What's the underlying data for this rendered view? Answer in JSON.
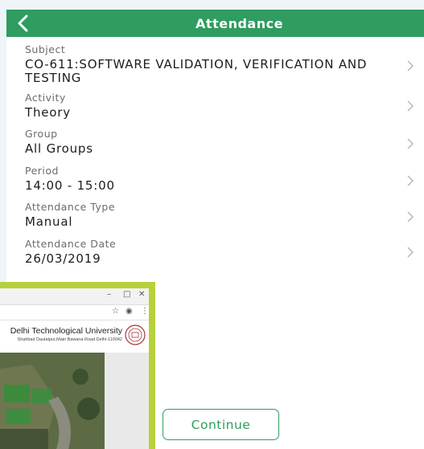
{
  "header": {
    "title": "Attendance"
  },
  "fields": [
    {
      "label": "Subject",
      "value": "CO-611:SOFTWARE VALIDATION, VERIFICATION AND TESTING"
    },
    {
      "label": "Activity",
      "value": "Theory"
    },
    {
      "label": "Group",
      "value": "All Groups"
    },
    {
      "label": "Period",
      "value": "14:00 - 15:00"
    },
    {
      "label": "Attendance Type",
      "value": "Manual"
    },
    {
      "label": "Attendance Date",
      "value": "26/03/2019"
    }
  ],
  "continue_label": "Continue",
  "inset": {
    "university_name": "Delhi Technological University",
    "university_address": "Shahbad Daulatpur,Main Bawana Road Delhi-110042"
  },
  "colors": {
    "brand": "#2e9d5f",
    "inset_border": "#b8d03a"
  },
  "icons": {
    "back": "chevron-left-icon",
    "row": "chevron-right-icon"
  }
}
